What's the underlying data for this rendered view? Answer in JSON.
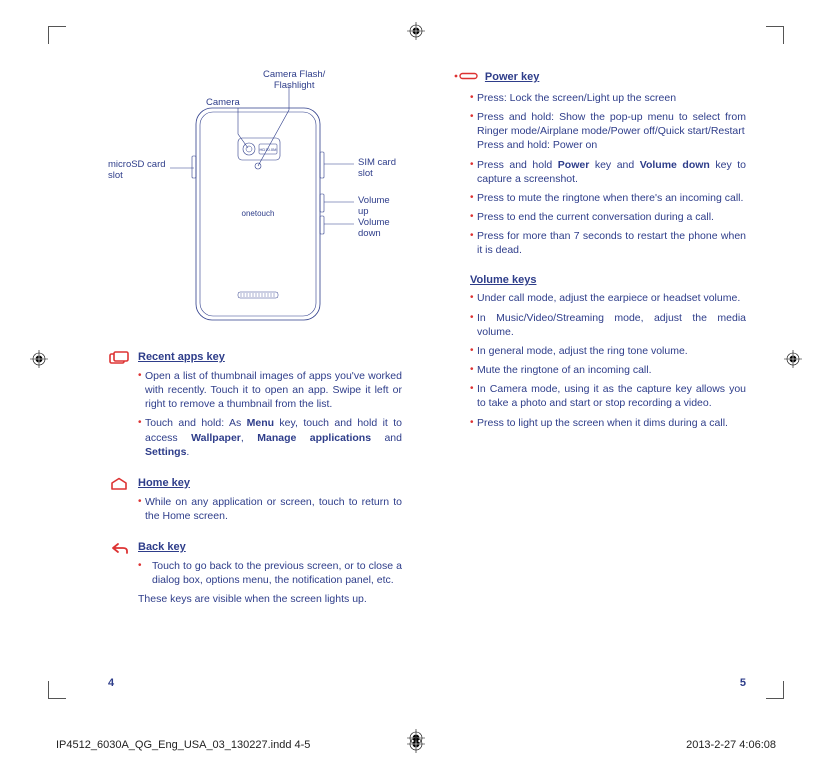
{
  "diagram": {
    "camera_flash": "Camera Flash/\nFlashlight",
    "camera": "Camera",
    "microsd": "microSD card\nslot",
    "sim": "SIM card slot",
    "vol_up": "Volume up",
    "vol_down": "Volume down",
    "brand": "onetouch",
    "sensor": "HD10.0M"
  },
  "recent": {
    "title": "Recent apps key",
    "b1": "Open a list of thumbnail images of apps you've worked with recently. Touch it to open an app. Swipe it left or right to remove a thumbnail from the list.",
    "b2_pre": "Touch and hold: As ",
    "b2_menu": "Menu",
    "b2_mid": " key, touch and hold it to access ",
    "b2_wall": "Wallpaper",
    "b2_sep1": ", ",
    "b2_manage": "Manage applications",
    "b2_sep2": " and ",
    "b2_settings": "Settings",
    "b2_end": "."
  },
  "home": {
    "title": "Home key",
    "b1": "While on any application or screen,  touch to return to the Home screen."
  },
  "back": {
    "title": "Back key",
    "b1": "Touch to go back to the previous screen, or to close a dialog box, options menu, the notification panel, etc.",
    "closing": "These keys are visible when the screen lights up."
  },
  "power": {
    "title": "Power key",
    "b1": "Press: Lock the screen/Light up the screen",
    "b2a": "Press and hold: Show the pop-up menu to select from Ringer mode/Airplane mode/Power off/Quick start/Restart",
    "b2b": "Press and hold: Power on",
    "b3_pre": "Press and hold ",
    "b3_pk": "Power",
    "b3_mid": " key and ",
    "b3_vd": "Volume down",
    "b3_post": " key to capture a screenshot.",
    "b4": "Press to mute the ringtone when there's an incoming call.",
    "b5": "Press to end the current conversation during a call.",
    "b6": "Press for more than 7 seconds to restart the phone when it is dead."
  },
  "volume": {
    "title": "Volume keys",
    "b1": "Under call mode, adjust the earpiece or headset volume.",
    "b2": "In Music/Video/Streaming mode, adjust the media volume.",
    "b3": "In general mode, adjust the ring tone volume.",
    "b4": "Mute the ringtone of an incoming call.",
    "b5": "In Camera mode, using it as the capture key allows you to take a photo and start or stop recording a video.",
    "b6": "Press to light up the screen when it dims during a call."
  },
  "pages": {
    "left": "4",
    "right": "5"
  },
  "footer": {
    "file": "IP4512_6030A_QG_Eng_USA_03_130227.indd   4-5",
    "stamp": "2013-2-27     4:06:08"
  }
}
